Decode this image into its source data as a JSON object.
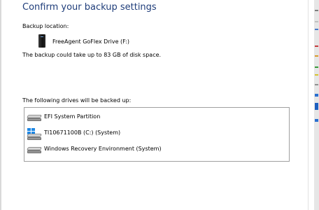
{
  "dialog": {
    "title": "Confirm your backup settings",
    "backup_location_label": "Backup location:",
    "destination_drive": "FreeAgent GoFlex Drive (F:)",
    "space_note": "The backup could take up to 83 GB of disk space.",
    "drives_header": "The following drives will be backed up:",
    "drives": [
      {
        "label": "EFI System Partition",
        "icon": "hard-drive-icon"
      },
      {
        "label": "TI10671100B (C:) (System)",
        "icon": "windows-drive-icon"
      },
      {
        "label": "Windows Recovery Environment (System)",
        "icon": "hard-drive-icon"
      }
    ]
  },
  "colors": {
    "title": "#1f3d7a",
    "windows_logo": "#1e88e5",
    "list_border": "#a0a0a0"
  }
}
